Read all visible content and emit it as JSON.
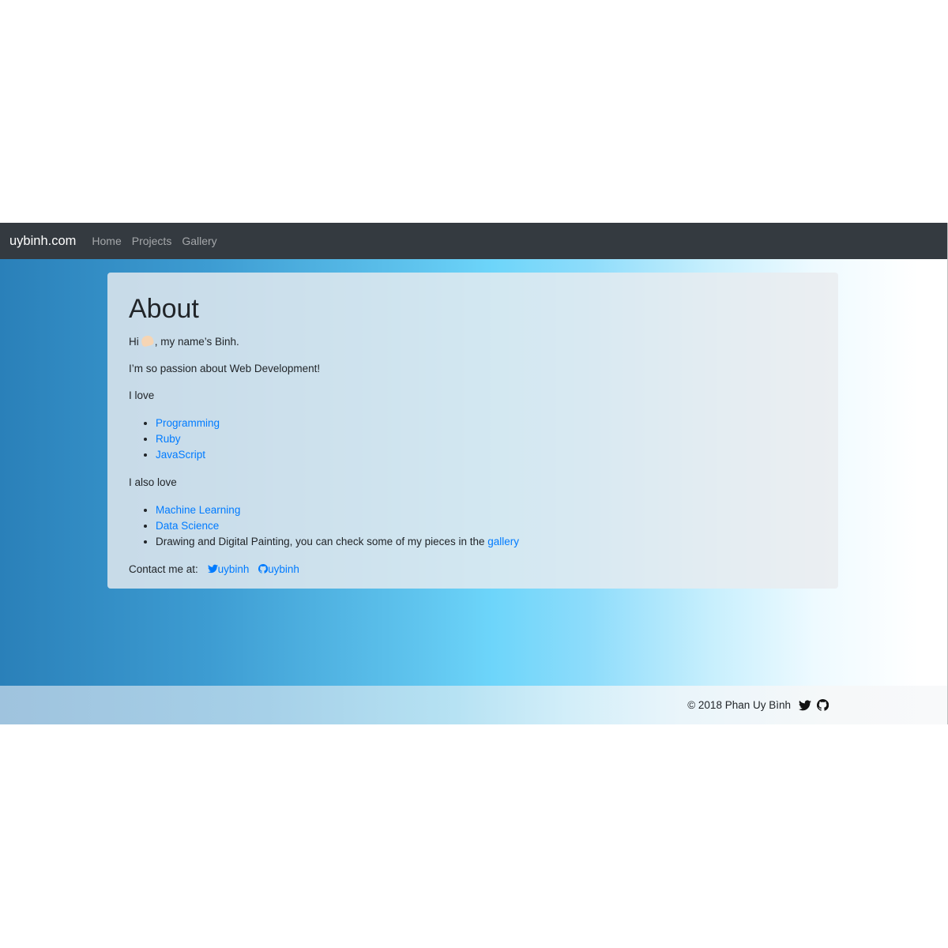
{
  "navbar": {
    "brand": "uybinh.com",
    "links": [
      "Home",
      "Projects",
      "Gallery"
    ]
  },
  "about": {
    "title": "About",
    "greeting_prefix": "Hi",
    "greeting_icon": "waving-hand-icon",
    "greeting_suffix": ", my name’s Binh.",
    "passion": "I’m so passion about Web Development!",
    "love_heading": "I love",
    "love_items": [
      "Programming",
      "Ruby",
      "JavaScript"
    ],
    "also_love_heading": "I also love",
    "also_love_items": [
      "Machine Learning",
      "Data Science"
    ],
    "drawing_text": "Drawing and Digital Painting, you can check some of my pieces in the",
    "gallery_link": "gallery",
    "contact_label": "Contact me at:",
    "twitter_handle": "uybinh",
    "github_handle": "uybinh"
  },
  "footer": {
    "copyright": "© 2018 Phan Uy Bình",
    "icons": [
      "twitter-icon",
      "github-icon"
    ]
  },
  "colors": {
    "navbar_bg": "#343a40",
    "link": "#007bff",
    "gradient_start": "#2a80b9",
    "gradient_mid": "#6dd5fa",
    "gradient_end": "#ffffff"
  }
}
